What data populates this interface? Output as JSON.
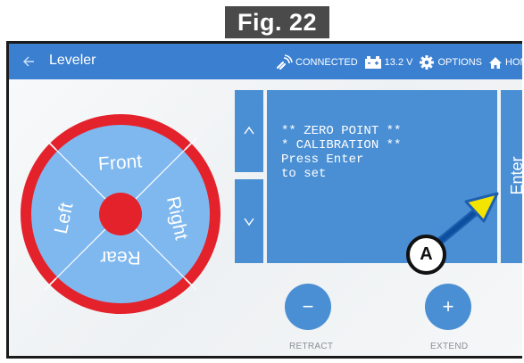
{
  "figure_label": "Fig. 22",
  "header": {
    "title": "Leveler",
    "status": {
      "connection": "CONNECTED",
      "battery_voltage": "13.2 V",
      "options_label": "OPTIONS",
      "home_label": "HOME"
    }
  },
  "dial": {
    "front": "Front",
    "right": "Right",
    "rear": "Rear",
    "left": "Left"
  },
  "display": {
    "lines": [
      "** ZERO POINT **",
      "* CALIBRATION **",
      "Press Enter",
      "to set"
    ]
  },
  "enter_label": "Enter",
  "retract": {
    "symbol": "−",
    "label": "RETRACT"
  },
  "extend": {
    "symbol": "+",
    "label": "EXTEND"
  },
  "callout": "A",
  "colors": {
    "topbar": "#3a7fd0",
    "button_blue": "#4a8fd4",
    "dial_blue": "#7fb8ef",
    "dial_red": "#e4222b",
    "callout_arrow": "#f4e500",
    "callout_arrow_border": "#1d5fb0"
  }
}
